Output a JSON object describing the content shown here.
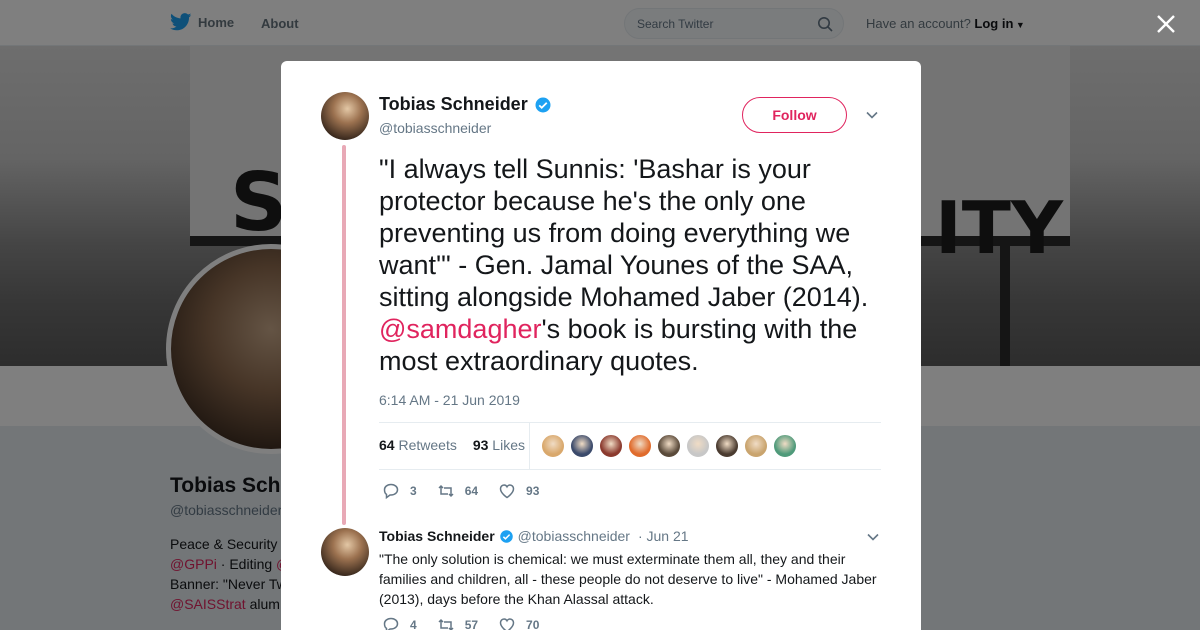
{
  "nav": {
    "home_label": "Home",
    "about_label": "About",
    "search_placeholder": "Search Twitter",
    "have_account": "Have an account?",
    "login_label": "Log in"
  },
  "banner": {
    "sign_left": "S",
    "sign_right": "ITY"
  },
  "profile": {
    "name": "Tobias Schneider",
    "handle": "@tobiasschneider",
    "bio_line1": "Peace & Security",
    "bio_line2_link": "@GPPi",
    "bio_line2_text": " · Editing ",
    "bio_line2_link2": "@",
    "bio_line3": "Banner: \"Never Tw",
    "bio_line4_link": "@SAISStrat",
    "bio_line4_text": " alum"
  },
  "tweet": {
    "author_name": "Tobias Schneider",
    "author_handle": "@tobiasschneider",
    "follow_label": "Follow",
    "text_before_mention": "\"I always tell Sunnis: 'Bashar is your protector because he's the only one preventing us from doing everything we want'\" - Gen. Jamal Younes of the SAA, sitting alongside Mohamed Jaber (2014). ",
    "mention": "@samdagher",
    "text_after_mention": "'s book is bursting with the most extraordinary quotes.",
    "timestamp": "6:14 AM - 21 Jun 2019",
    "retweets_count": "64",
    "retweets_label": "Retweets",
    "likes_count": "93",
    "likes_label": "Likes",
    "reply_count": "3",
    "retweet_action_count": "64",
    "like_action_count": "93",
    "liker_colors": [
      "#d9a86c",
      "#3b4a6b",
      "#8b3a2e",
      "#e06b2c",
      "#5a4a3a",
      "#c7c7c7",
      "#4a3b30",
      "#c9a46e",
      "#4f9a7a"
    ]
  },
  "reply": {
    "author_name": "Tobias Schneider",
    "author_handle": "@tobiasschneider",
    "date": "· Jun 21",
    "text": "\"The only solution is chemical: we must exterminate them all, they and their families and children, all - these people do not deserve to live\" - Mohamed Jaber (2013), days before the Khan Alassal attack.",
    "reply_count": "4",
    "retweet_count": "57",
    "like_count": "70"
  },
  "colors": {
    "accent": "#e0245e",
    "verified": "#1da1f2",
    "thread_line": "#e8a9b6"
  }
}
